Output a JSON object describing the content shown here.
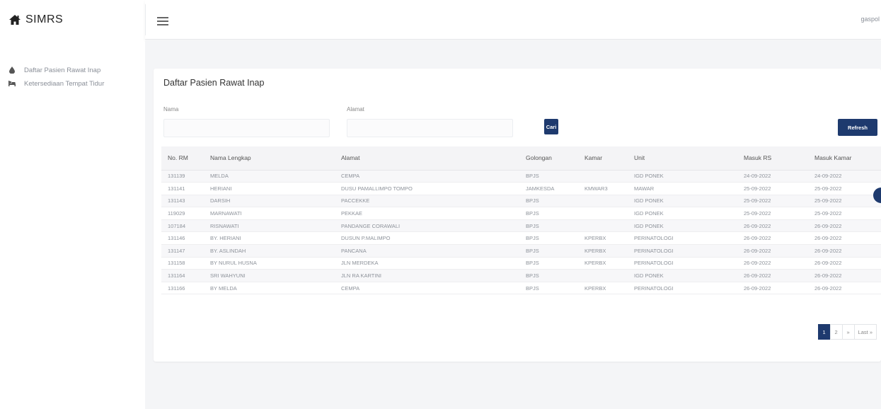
{
  "brand": {
    "name": "SIMRS",
    "icon": "home-icon"
  },
  "sidebar": {
    "items": [
      {
        "label": "Daftar Pasien Rawat Inap",
        "icon": "tint-icon"
      },
      {
        "label": "Ketersediaan Tempat Tidur",
        "icon": "bed-icon"
      }
    ]
  },
  "topbar": {
    "user": "gaspol"
  },
  "card": {
    "title": "Daftar Pasien Rawat Inap",
    "nama_label": "Nama",
    "nama_value": "",
    "alamat_label": "Alamat",
    "alamat_value": "",
    "cari_label": "Cari",
    "refresh_label": "Refresh"
  },
  "table": {
    "headers": [
      "No. RM",
      "Nama Lengkap",
      "Alamat",
      "Golongan",
      "Kamar",
      "Unit",
      "Masuk RS",
      "Masuk Kamar"
    ],
    "rows": [
      [
        "131139",
        "MELDA",
        "CEMPA",
        "BPJS",
        "",
        "IGD PONEK",
        "24-09-2022",
        "24-09-2022"
      ],
      [
        "131141",
        "HERIANI",
        "DUSU PAMALLIMPO TOMPO",
        "JAMKESDA",
        "KMWAR3",
        "MAWAR",
        "25-09-2022",
        "25-09-2022"
      ],
      [
        "131143",
        "DARSIH",
        "PACCEKKE",
        "BPJS",
        "",
        "IGD PONEK",
        "25-09-2022",
        "25-09-2022"
      ],
      [
        "119029",
        "MARNAWATI",
        "PEKKAE",
        "BPJS",
        "",
        "IGD PONEK",
        "25-09-2022",
        "25-09-2022"
      ],
      [
        "107184",
        "RISNAWATI",
        "PANDANGE CORAWALI",
        "BPJS",
        "",
        "IGD PONEK",
        "26-09-2022",
        "26-09-2022"
      ],
      [
        "131146",
        "BY. HERIANI",
        "DUSUN P.MALIMPO",
        "BPJS",
        "KPERBX",
        "PERINATOLOGI",
        "26-09-2022",
        "26-09-2022"
      ],
      [
        "131147",
        "BY. ASLINDAH",
        "PANCANA",
        "BPJS",
        "KPERBX",
        "PERINATOLOGI",
        "26-09-2022",
        "26-09-2022"
      ],
      [
        "131158",
        "BY NURUL HUSNA",
        "JLN MERDEKA",
        "BPJS",
        "KPERBX",
        "PERINATOLOGI",
        "26-09-2022",
        "26-09-2022"
      ],
      [
        "131164",
        "SRI WAHYUNI",
        "JLN RA KARTINI",
        "BPJS",
        "",
        "IGD PONEK",
        "26-09-2022",
        "26-09-2022"
      ],
      [
        "131166",
        "BY MELDA",
        "CEMPA",
        "BPJS",
        "KPERBX",
        "PERINATOLOGI",
        "26-09-2022",
        "26-09-2022"
      ]
    ]
  },
  "pagination": {
    "pages": [
      "1",
      "2",
      "»",
      "Last »"
    ],
    "active": "1"
  },
  "colors": {
    "primary": "#1e3a6e",
    "background": "#f4f5f7"
  }
}
